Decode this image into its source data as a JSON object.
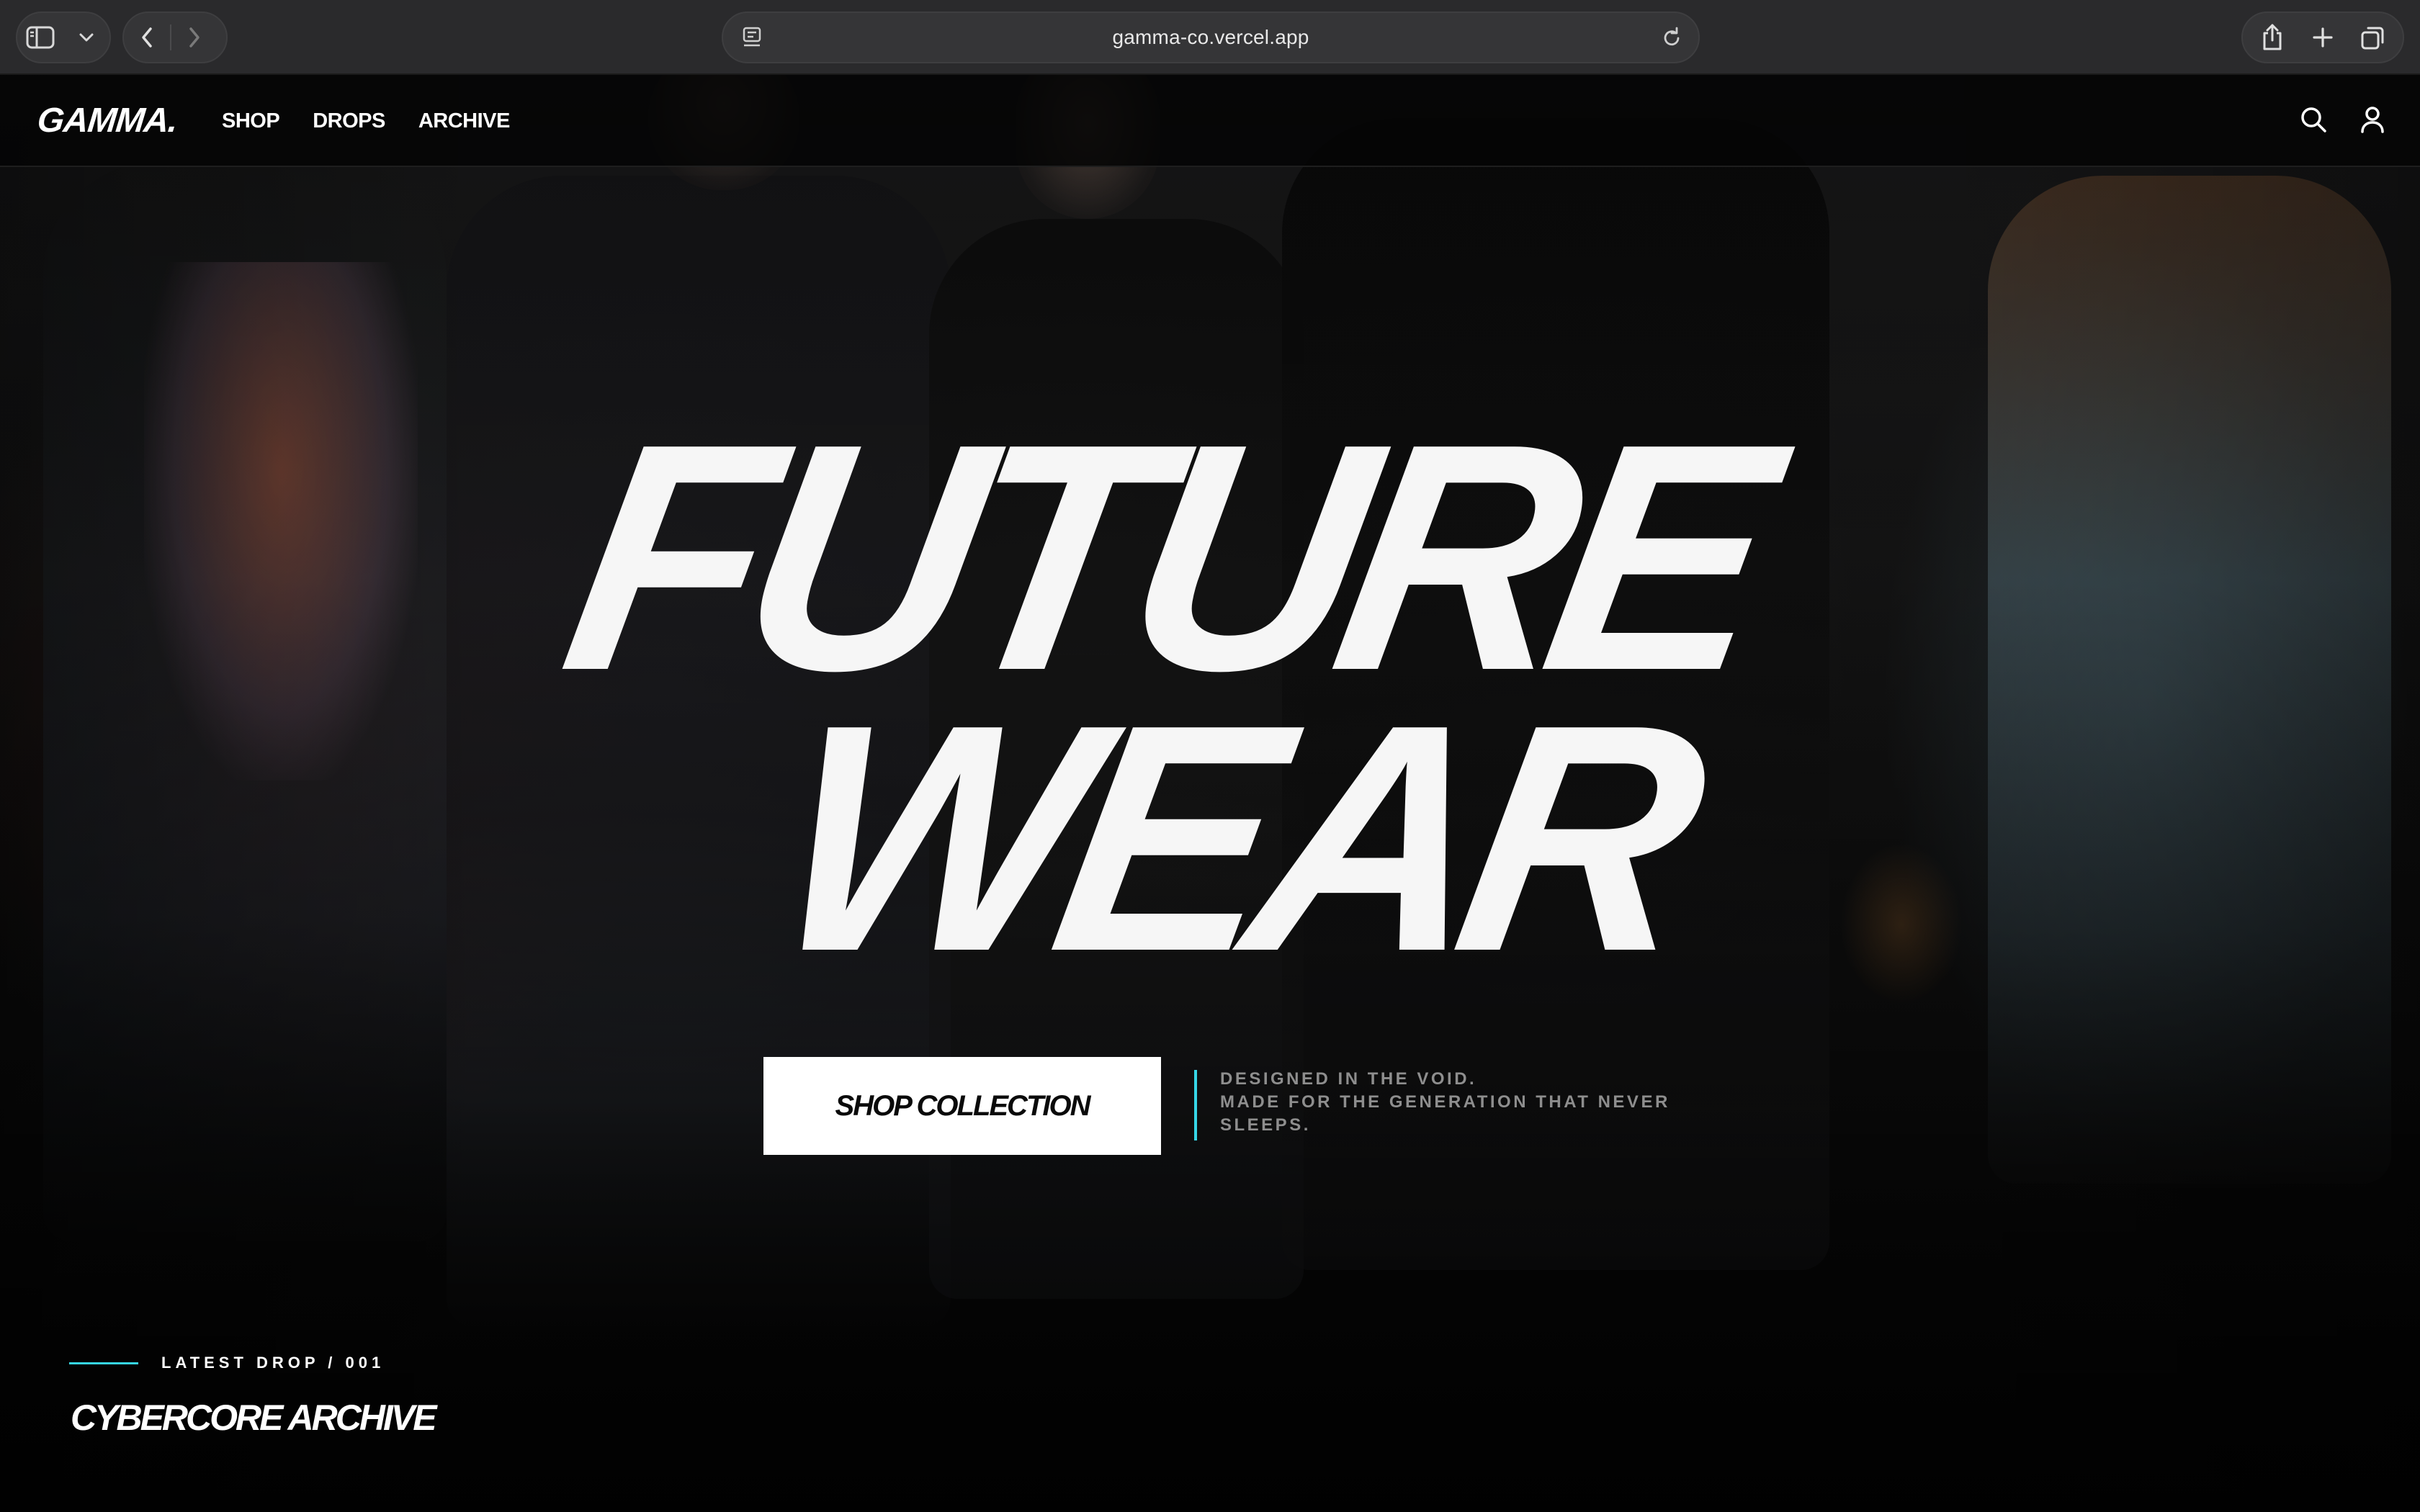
{
  "browser": {
    "url": "gamma-co.vercel.app",
    "icons": {
      "sidebar": "sidebar-toggle-icon",
      "tab_overview_menu": "chevron-down-icon",
      "back": "chevron-left-icon",
      "forward": "chevron-right-icon",
      "reader": "reader-mode-icon",
      "reload": "reload-icon",
      "share": "share-icon",
      "new_tab": "plus-icon",
      "tabs": "tab-overview-icon"
    }
  },
  "site": {
    "logo": "GAMMA.",
    "nav": [
      {
        "label": "SHOP"
      },
      {
        "label": "DROPS"
      },
      {
        "label": "ARCHIVE"
      }
    ],
    "icons": {
      "search": "search-icon",
      "account": "user-icon"
    }
  },
  "hero": {
    "headline_line1": "FUTURE",
    "headline_line2": "WEAR",
    "cta_label": "SHOP COLLECTION",
    "tagline_line1": "DESIGNED IN THE VOID.",
    "tagline_line2": "MADE FOR THE GENERATION THAT NEVER",
    "tagline_line3": "SLEEPS.",
    "accent_color": "#36d6e7"
  },
  "latest_drop": {
    "label": "LATEST DROP / 001",
    "title": "CYBERCORE ARCHIVE"
  }
}
